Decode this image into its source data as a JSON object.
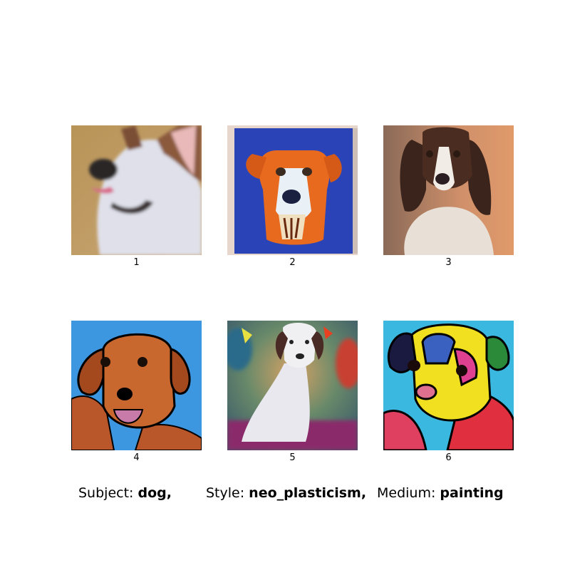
{
  "images": [
    {
      "index": "1",
      "subject": "dog-portrait-blurred-white-brown"
    },
    {
      "index": "2",
      "subject": "dog-canvas-orange-blue"
    },
    {
      "index": "3",
      "subject": "dog-spaniel-brown-white"
    },
    {
      "index": "4",
      "subject": "dog-cartoon-brown-blue-background"
    },
    {
      "index": "5",
      "subject": "dog-white-sitting-colorful-background"
    },
    {
      "index": "6",
      "subject": "dog-multicolor-pop-art"
    }
  ],
  "caption": {
    "subject_label": "Subject:",
    "subject_value": "dog,",
    "style_label": "Style:",
    "style_value": "neo_plasticism,",
    "medium_label": "Medium:",
    "medium_value": "painting"
  }
}
